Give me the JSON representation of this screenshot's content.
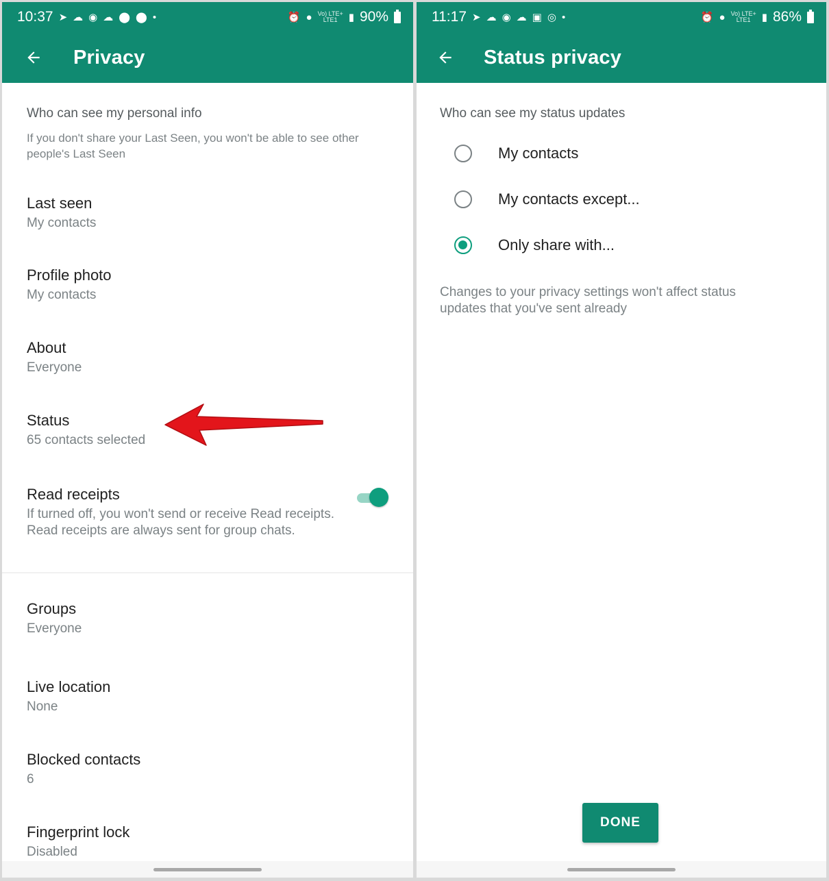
{
  "left": {
    "statusbar": {
      "time": "10:37",
      "network_top": "Vo) LTE+",
      "network_bottom": "LTE1",
      "battery": "90%"
    },
    "appbar": {
      "title": "Privacy"
    },
    "section": {
      "header": "Who can see my personal info",
      "description": "If you don't share your Last Seen, you won't be able to see other people's Last Seen"
    },
    "rows": [
      {
        "title": "Last seen",
        "value": "My contacts"
      },
      {
        "title": "Profile photo",
        "value": "My contacts"
      },
      {
        "title": "About",
        "value": "Everyone"
      },
      {
        "title": "Status",
        "value": "65 contacts selected"
      }
    ],
    "read_receipts": {
      "title": "Read receipts",
      "description": "If turned off, you won't send or receive Read receipts. Read receipts are always sent for group chats.",
      "enabled": true
    },
    "rows2": [
      {
        "title": "Groups",
        "value": "Everyone"
      },
      {
        "title": "Live location",
        "value": "None"
      },
      {
        "title": "Blocked contacts",
        "value": "6"
      },
      {
        "title": "Fingerprint lock",
        "value": "Disabled"
      }
    ]
  },
  "right": {
    "statusbar": {
      "time": "11:17",
      "network_top": "Vo) LTE+",
      "network_bottom": "LTE1",
      "battery": "86%"
    },
    "appbar": {
      "title": "Status privacy"
    },
    "header": "Who can see my status updates",
    "options": [
      {
        "label": "My contacts",
        "selected": false
      },
      {
        "label": "My contacts except...",
        "selected": false
      },
      {
        "label": "Only share with...",
        "selected": true
      }
    ],
    "note": "Changes to your privacy settings won't affect status updates that you've sent already",
    "done_label": "DONE"
  },
  "colors": {
    "brand": "#108a71",
    "accent": "#0e9e7e",
    "annotation_arrow": "#e3151b"
  }
}
